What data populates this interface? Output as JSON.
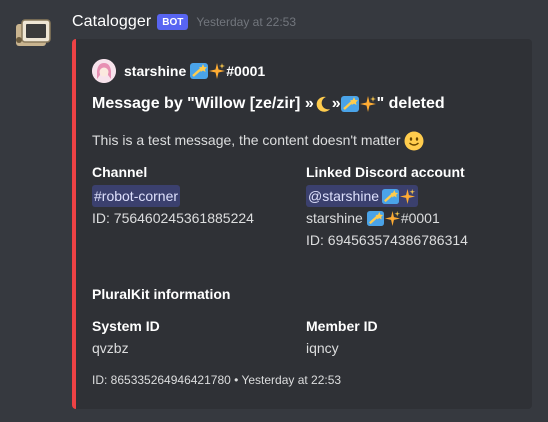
{
  "message": {
    "author": "Catalogger",
    "bot_tag": "BOT",
    "timestamp": "Yesterday at 22:53"
  },
  "embed": {
    "accent_color": "#ed4245",
    "author_name": "starshine",
    "author_suffix": "#0001",
    "title_prefix": "Message by \"Willow [ze/zir] » ",
    "title_mid": " » ",
    "title_suffix": "\" deleted",
    "description": "This is a test message, the content doesn't matter",
    "fields": {
      "channel": {
        "name": "Channel",
        "mention": "#robot-corner",
        "id_line": "ID: 756460245361885224"
      },
      "linked_account": {
        "name": "Linked Discord account",
        "mention": "@starshine",
        "user_name": "starshine",
        "user_suffix": "#0001",
        "id_line": "ID: 694563574386786314"
      },
      "pluralkit_heading": "PluralKit information",
      "system_id": {
        "name": "System ID",
        "value": "qvzbz"
      },
      "member_id": {
        "name": "Member ID",
        "value": "iqncy"
      }
    },
    "footer": "ID: 865335264946421780 • Yesterday at 22:53"
  },
  "icons": [
    "bot-avatar-icon",
    "author-avatar-icon",
    "shooting-star-emoji",
    "sparkles-emoji",
    "crescent-moon-emoji",
    "slight-smile-emoji"
  ]
}
